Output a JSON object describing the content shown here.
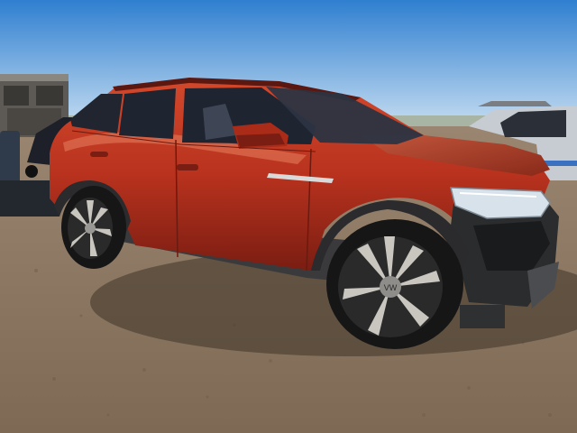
{
  "scene": {
    "subject": "red-compact-electric-suv-front-damage",
    "colors": {
      "sky_top": "#2f7fd0",
      "sky_bottom": "#cfe3f3",
      "ground": "#8c7760",
      "ground_dark": "#6b5a48",
      "body_red": "#b8321e",
      "body_red_dark": "#7a1d12",
      "body_highlight": "#e0684a",
      "glass": "#1e2430",
      "tire": "#161616",
      "rim_silver": "#c9c6c0",
      "rim_dark": "#2a2a2a",
      "trim_gray": "#6e7278",
      "silver_car": "#c7ccd3"
    },
    "wheel_logo": "VW"
  }
}
